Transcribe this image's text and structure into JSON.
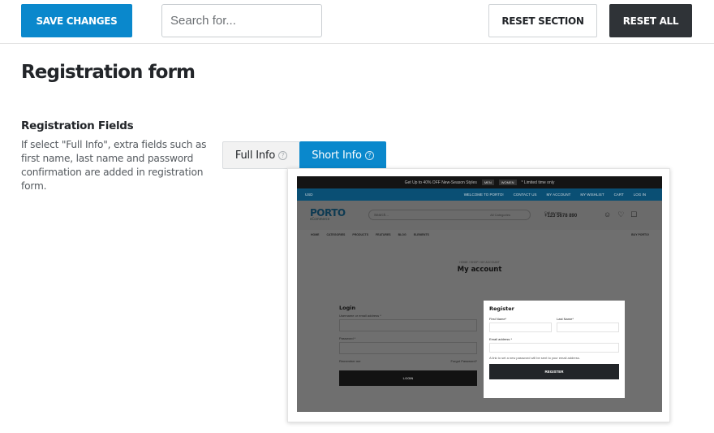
{
  "toolbar": {
    "save_label": "SAVE CHANGES",
    "search_placeholder": "Search for...",
    "reset_section_label": "RESET SECTION",
    "reset_all_label": "RESET ALL"
  },
  "page": {
    "title": "Registration form"
  },
  "field": {
    "label": "Registration Fields",
    "description": "If select \"Full Info\", extra fields such as first name, last name and password confirmation are added in registration form.",
    "options": [
      {
        "label": "Full Info",
        "selected": false
      },
      {
        "label": "Short Info",
        "selected": true
      }
    ],
    "help_glyph": "?"
  },
  "preview": {
    "promo": "Get Up to 40% OFF New-Season Styles",
    "promo_tags": [
      "MEN",
      "WOMEN"
    ],
    "promo_note": "* Limited time only",
    "topbar_left": "USD",
    "topbar_links": [
      "WELCOME TO PORTO!",
      "CONTACT US",
      "MY ACCOUNT",
      "MY WISHLIST",
      "CART",
      "LOG IN"
    ],
    "logo": "PORTO",
    "logo_sub": "eCommerce",
    "search_placeholder": "Search...",
    "search_category": "All Categories",
    "phone_label": "Call us now",
    "phone": "+123 5678 890",
    "nav": [
      "HOME",
      "CATEGORIES",
      "PRODUCTS",
      "FEATURES",
      "BLOG",
      "ELEMENTS"
    ],
    "nav_right": "BUY PORTO!",
    "breadcrumb": "HOME  /  SHOP  /  MY ACCOUNT",
    "title": "My account",
    "login": {
      "heading": "Login",
      "username_label": "Username or email address *",
      "password_label": "Password *",
      "remember": "Remember me",
      "forgot": "Forgot Password?",
      "button": "LOGIN"
    },
    "register": {
      "heading": "Register",
      "first_name": "First Name*",
      "last_name": "Last Name*",
      "email_label": "Email address *",
      "note": "A link to set a new password will be sent to your email address.",
      "button": "REGISTER"
    }
  },
  "colors": {
    "primary": "#0a88cc",
    "dark": "#2f3337",
    "text": "#222529"
  }
}
